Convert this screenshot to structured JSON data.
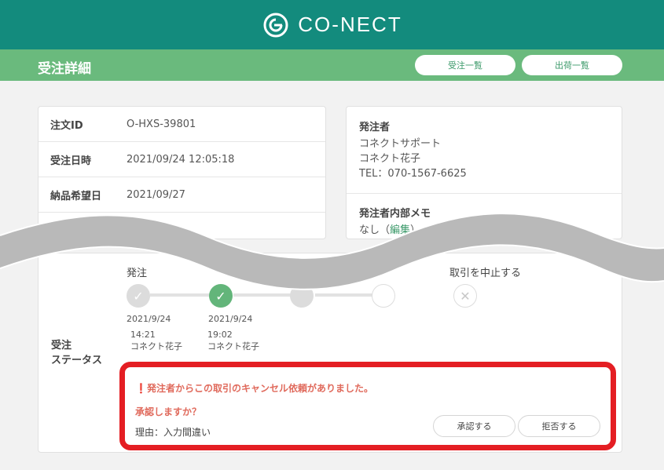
{
  "app": {
    "logo_text": "CO-NECT"
  },
  "header": {
    "page_title": "受注詳細",
    "orders_list_label": "受注一覧",
    "shipments_list_label": "出荷一覧"
  },
  "order_info": {
    "rows": [
      {
        "label": "注文ID",
        "value": "O-HXS-39801"
      },
      {
        "label": "受注日時",
        "value": "2021/09/24 12:05:18"
      },
      {
        "label": "納品希望日",
        "value": "2021/09/27"
      }
    ]
  },
  "orderer": {
    "title": "発注者",
    "company": "コネクトサポート",
    "person": "コネクト花子",
    "tel": "TEL：070-1567-6625",
    "memo_title": "発注者内部メモ",
    "memo_value": "なし",
    "memo_edit": "編集"
  },
  "status": {
    "label_line1": "受注",
    "label_line2": "ステータス",
    "steps": [
      {
        "name": "発注",
        "date": "2021/9/24",
        "time": "14:21",
        "by": "コネクト花子",
        "state": "done"
      },
      {
        "name": "",
        "date": "2021/9/24",
        "time": "19:02",
        "by": "コネクト花子",
        "state": "current"
      },
      {
        "name": "",
        "date": "",
        "time": "",
        "by": "",
        "state": "pending"
      },
      {
        "name": "",
        "date": "",
        "time": "",
        "by": "",
        "state": "pending"
      }
    ],
    "cancel_step_label": "取引を中止する"
  },
  "cancel_request": {
    "message": "❗発注者からこの取引のキャンセル依頼がありました。",
    "question": "承認しますか？",
    "reason": "理由：入力間違い",
    "approve_label": "承認する",
    "reject_label": "拒否する"
  },
  "colors": {
    "header_teal": "#138b7d",
    "subheader_green": "#6aba7d",
    "accent_green": "#63b57a",
    "alert_red": "#e41e23",
    "alert_text": "#e06a5c"
  }
}
